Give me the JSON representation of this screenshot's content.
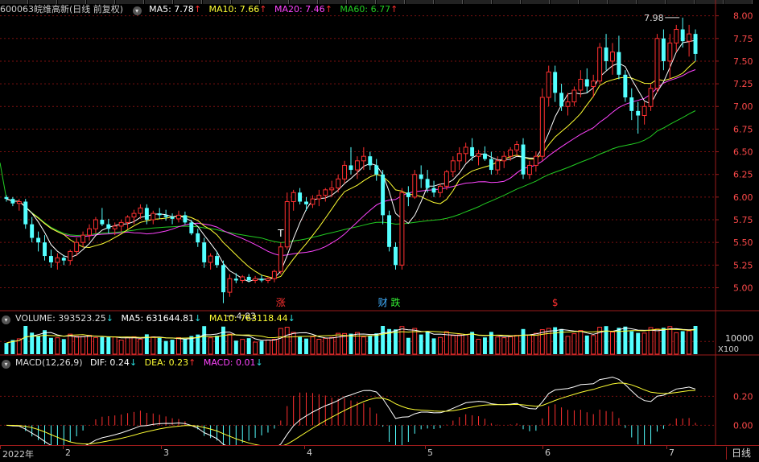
{
  "stock": {
    "code": "600063",
    "name": "皖维高新",
    "mode": "(日线 前复权)"
  },
  "ma": {
    "ma5": {
      "label": "MA5: 7.78",
      "arrow": "↑",
      "color": "#ffffff"
    },
    "ma10": {
      "label": "MA10: 7.66",
      "arrow": "↑",
      "color": "#ffff33"
    },
    "ma20": {
      "label": "MA20: 7.46",
      "arrow": "↑",
      "color": "#ff44ff"
    },
    "ma60": {
      "label": "MA60: 6.77",
      "arrow": "↑",
      "color": "#22cc22"
    }
  },
  "volume": {
    "label": "VOLUME: 393523.25",
    "arrow": "↓",
    "ma5": "MA5: 631644.81",
    "ma5_arrow": "↓",
    "ma10": "MA10: 763118.44",
    "ma10_arrow": "↓",
    "scale": "X100",
    "tick": "10000"
  },
  "macd": {
    "label": "MACD(12,26,9)",
    "dif": "DIF: 0.24",
    "dif_arrow": "↓",
    "dea": "DEA: 0.23",
    "dea_arrow": "↑",
    "macd": "MACD: 0.01",
    "macd_arrow": "↓",
    "ticks": [
      "0.20",
      "0.00"
    ]
  },
  "annotations": {
    "high": "7.98",
    "low": "4.83",
    "markers": [
      {
        "text": "涨",
        "color": "#ff3030"
      },
      {
        "text": "财",
        "color": "#40b0ff"
      },
      {
        "text": "跌",
        "color": "#33ee33"
      },
      {
        "text": "$",
        "color": "#ff3030"
      },
      {
        "text": "T",
        "color": "#ffffff"
      }
    ]
  },
  "price_ticks": [
    "8.00",
    "7.75",
    "7.50",
    "7.25",
    "7.00",
    "6.75",
    "6.50",
    "6.25",
    "6.00",
    "5.75",
    "5.50",
    "5.25",
    "5.00"
  ],
  "x_labels": [
    "2022年",
    "2",
    "3",
    "4",
    "5",
    "6",
    "7"
  ],
  "period_button": "日线",
  "colors": {
    "up": "#ff3030",
    "down": "#54ffff",
    "grid": "#7a1010",
    "frame": "#9b1b1b"
  },
  "chart_data": {
    "type": "candlestick",
    "price_range": [
      4.8,
      8.05
    ],
    "candles": [
      [
        6.0,
        6.02,
        5.95,
        5.98
      ],
      [
        5.98,
        6.0,
        5.9,
        5.93
      ],
      [
        5.93,
        5.98,
        5.85,
        5.95
      ],
      [
        5.95,
        5.98,
        5.65,
        5.7
      ],
      [
        5.7,
        5.78,
        5.5,
        5.55
      ],
      [
        5.55,
        5.62,
        5.4,
        5.5
      ],
      [
        5.5,
        5.58,
        5.3,
        5.35
      ],
      [
        5.35,
        5.42,
        5.22,
        5.28
      ],
      [
        5.28,
        5.38,
        5.2,
        5.33
      ],
      [
        5.33,
        5.36,
        5.25,
        5.3
      ],
      [
        5.3,
        5.42,
        5.25,
        5.4
      ],
      [
        5.4,
        5.55,
        5.35,
        5.5
      ],
      [
        5.5,
        5.62,
        5.45,
        5.58
      ],
      [
        5.58,
        5.7,
        5.52,
        5.65
      ],
      [
        5.65,
        5.78,
        5.6,
        5.75
      ],
      [
        5.75,
        5.88,
        5.68,
        5.7
      ],
      [
        5.7,
        5.76,
        5.6,
        5.65
      ],
      [
        5.65,
        5.72,
        5.58,
        5.68
      ],
      [
        5.68,
        5.75,
        5.62,
        5.72
      ],
      [
        5.72,
        5.8,
        5.65,
        5.78
      ],
      [
        5.78,
        5.86,
        5.7,
        5.82
      ],
      [
        5.82,
        5.92,
        5.76,
        5.88
      ],
      [
        5.88,
        5.92,
        5.7,
        5.75
      ],
      [
        5.75,
        5.85,
        5.7,
        5.82
      ],
      [
        5.82,
        5.88,
        5.76,
        5.8
      ],
      [
        5.8,
        5.86,
        5.74,
        5.78
      ],
      [
        5.78,
        5.82,
        5.7,
        5.76
      ],
      [
        5.76,
        5.85,
        5.72,
        5.8
      ],
      [
        5.8,
        5.84,
        5.7,
        5.72
      ],
      [
        5.72,
        5.75,
        5.58,
        5.6
      ],
      [
        5.6,
        5.65,
        5.45,
        5.5
      ],
      [
        5.5,
        5.55,
        5.22,
        5.28
      ],
      [
        5.28,
        5.38,
        5.2,
        5.35
      ],
      [
        5.35,
        5.4,
        5.22,
        5.25
      ],
      [
        5.25,
        5.3,
        4.83,
        4.95
      ],
      [
        4.95,
        5.15,
        4.9,
        5.1
      ],
      [
        5.1,
        5.16,
        5.05,
        5.08
      ],
      [
        5.08,
        5.14,
        5.05,
        5.12
      ],
      [
        5.12,
        5.15,
        5.06,
        5.08
      ],
      [
        5.08,
        5.13,
        5.05,
        5.1
      ],
      [
        5.1,
        5.14,
        5.06,
        5.08
      ],
      [
        5.08,
        5.12,
        5.05,
        5.1
      ],
      [
        5.1,
        5.2,
        5.06,
        5.18
      ],
      [
        5.18,
        5.5,
        5.15,
        5.45
      ],
      [
        5.45,
        6.05,
        5.42,
        5.95
      ],
      [
        5.95,
        6.08,
        5.85,
        6.05
      ],
      [
        6.05,
        6.1,
        5.92,
        5.95
      ],
      [
        5.95,
        6.0,
        5.85,
        5.92
      ],
      [
        5.92,
        6.02,
        5.88,
        5.98
      ],
      [
        5.98,
        6.08,
        5.9,
        6.02
      ],
      [
        6.02,
        6.1,
        5.95,
        6.08
      ],
      [
        6.08,
        6.18,
        6.0,
        6.1
      ],
      [
        6.1,
        6.25,
        6.05,
        6.2
      ],
      [
        6.2,
        6.4,
        6.15,
        6.35
      ],
      [
        6.35,
        6.55,
        6.25,
        6.3
      ],
      [
        6.3,
        6.45,
        6.2,
        6.4
      ],
      [
        6.4,
        6.55,
        6.3,
        6.45
      ],
      [
        6.45,
        6.5,
        6.3,
        6.35
      ],
      [
        6.35,
        6.42,
        6.18,
        6.25
      ],
      [
        6.25,
        6.3,
        5.7,
        5.8
      ],
      [
        5.8,
        5.85,
        5.4,
        5.45
      ],
      [
        5.45,
        5.5,
        5.2,
        5.25
      ],
      [
        5.25,
        6.1,
        5.2,
        6.05
      ],
      [
        6.05,
        6.12,
        5.9,
        6.0
      ],
      [
        6.0,
        6.3,
        5.98,
        6.25
      ],
      [
        6.25,
        6.35,
        6.1,
        6.2
      ],
      [
        6.2,
        6.3,
        6.05,
        6.1
      ],
      [
        6.1,
        6.18,
        6.0,
        6.05
      ],
      [
        6.05,
        6.15,
        6.0,
        6.12
      ],
      [
        6.12,
        6.3,
        6.08,
        6.28
      ],
      [
        6.28,
        6.45,
        6.22,
        6.4
      ],
      [
        6.4,
        6.55,
        6.3,
        6.48
      ],
      [
        6.48,
        6.6,
        6.38,
        6.55
      ],
      [
        6.55,
        6.65,
        6.4,
        6.45
      ],
      [
        6.45,
        6.52,
        6.35,
        6.48
      ],
      [
        6.48,
        6.56,
        6.4,
        6.42
      ],
      [
        6.42,
        6.5,
        6.25,
        6.3
      ],
      [
        6.3,
        6.45,
        6.25,
        6.4
      ],
      [
        6.4,
        6.5,
        6.32,
        6.45
      ],
      [
        6.45,
        6.55,
        6.4,
        6.52
      ],
      [
        6.52,
        6.62,
        6.45,
        6.58
      ],
      [
        6.58,
        6.65,
        6.2,
        6.25
      ],
      [
        6.25,
        6.4,
        6.2,
        6.35
      ],
      [
        6.35,
        6.5,
        6.28,
        6.45
      ],
      [
        6.45,
        7.2,
        6.4,
        7.1
      ],
      [
        7.1,
        7.45,
        7.0,
        7.38
      ],
      [
        7.38,
        7.45,
        7.05,
        7.15
      ],
      [
        7.15,
        7.25,
        6.95,
        7.0
      ],
      [
        7.0,
        7.15,
        6.9,
        7.05
      ],
      [
        7.05,
        7.22,
        7.0,
        7.18
      ],
      [
        7.18,
        7.4,
        7.1,
        7.3
      ],
      [
        7.3,
        7.42,
        7.15,
        7.22
      ],
      [
        7.22,
        7.35,
        7.1,
        7.28
      ],
      [
        7.28,
        7.7,
        7.25,
        7.65
      ],
      [
        7.65,
        7.8,
        7.4,
        7.5
      ],
      [
        7.5,
        7.7,
        7.35,
        7.6
      ],
      [
        7.6,
        7.78,
        7.3,
        7.35
      ],
      [
        7.35,
        7.4,
        7.05,
        7.1
      ],
      [
        7.1,
        7.2,
        6.85,
        6.95
      ],
      [
        6.95,
        7.05,
        6.7,
        6.9
      ],
      [
        6.9,
        7.05,
        6.8,
        7.0
      ],
      [
        7.0,
        7.25,
        6.95,
        7.2
      ],
      [
        7.2,
        7.8,
        7.15,
        7.75
      ],
      [
        7.75,
        7.85,
        7.4,
        7.5
      ],
      [
        7.5,
        7.8,
        7.3,
        7.7
      ],
      [
        7.7,
        7.9,
        7.6,
        7.85
      ],
      [
        7.85,
        7.98,
        7.65,
        7.72
      ],
      [
        7.72,
        7.9,
        7.55,
        7.8
      ],
      [
        7.8,
        7.85,
        7.5,
        7.58
      ]
    ]
  }
}
